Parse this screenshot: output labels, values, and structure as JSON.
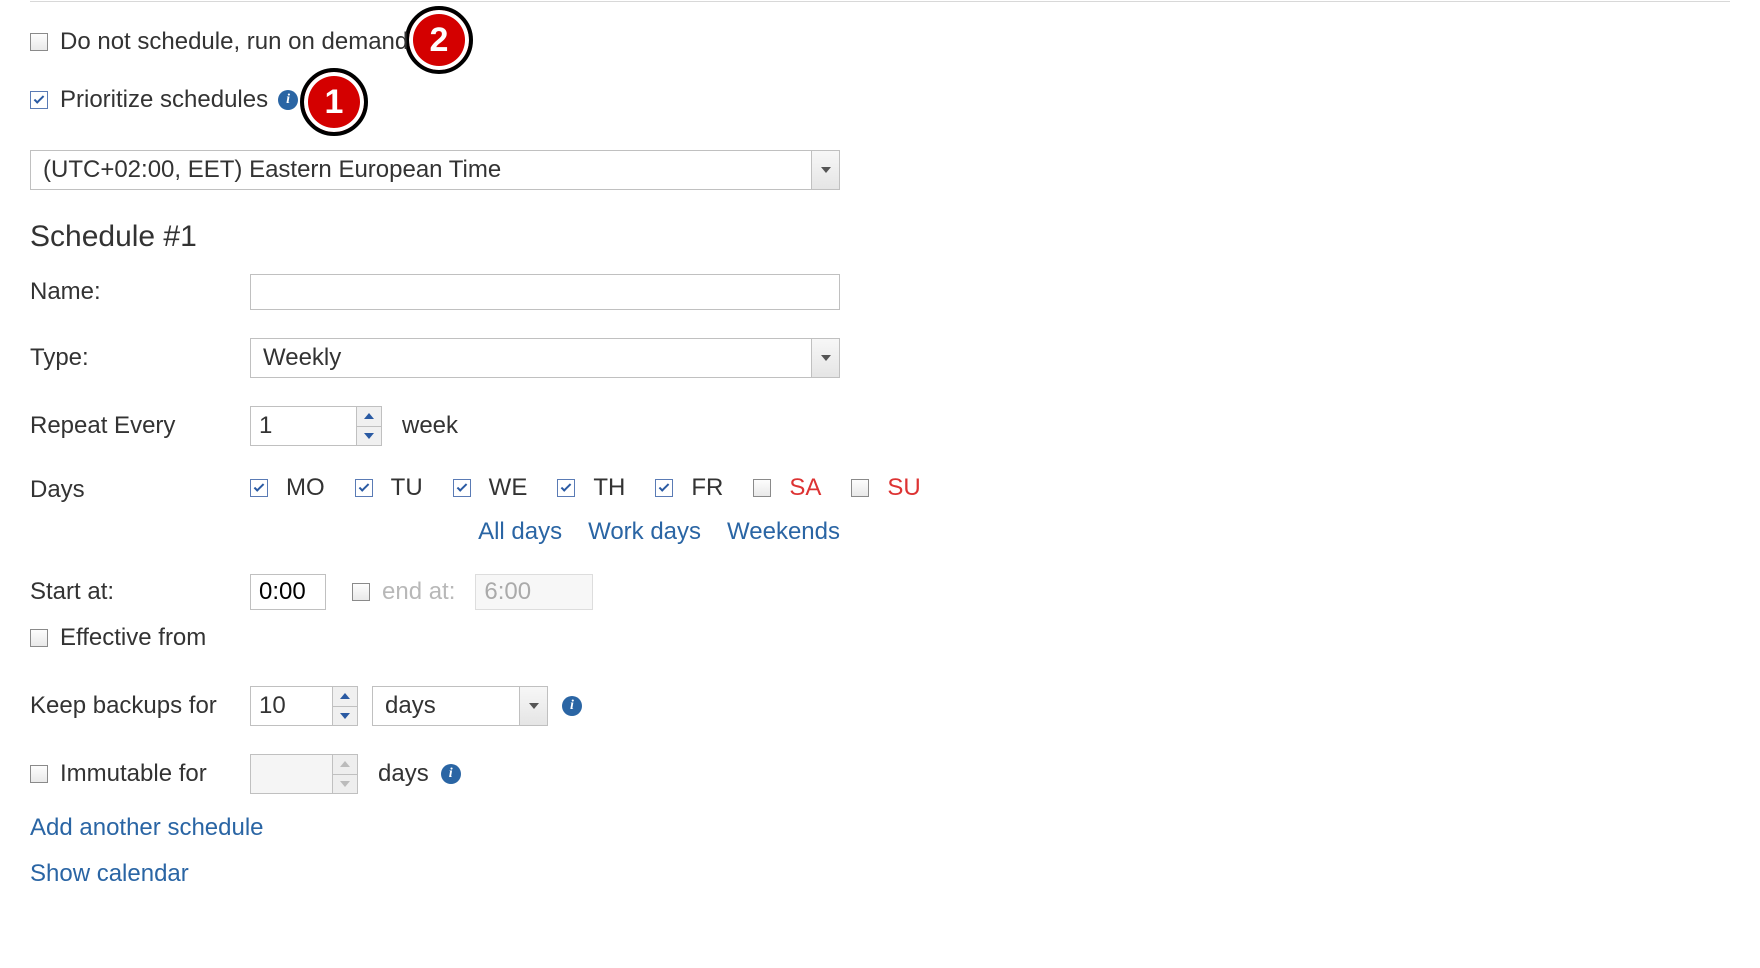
{
  "options": {
    "run_on_demand_label": "Do not schedule, run on demand",
    "prioritize_label": "Prioritize schedules",
    "timezone_selected": "(UTC+02:00, EET) Eastern European Time"
  },
  "badges": {
    "b1": "1",
    "b2": "2"
  },
  "schedule": {
    "heading": "Schedule #1",
    "name_label": "Name:",
    "name_value": "",
    "type_label": "Type:",
    "type_selected": "Weekly",
    "repeat_label": "Repeat Every",
    "repeat_value": "1",
    "repeat_unit": "week",
    "days_label": "Days",
    "days": [
      "MO",
      "TU",
      "WE",
      "TH",
      "FR",
      "SA",
      "SU"
    ],
    "presets": {
      "all": "All days",
      "work": "Work days",
      "weekends": "Weekends"
    },
    "start_label": "Start at:",
    "start_value": "0:00",
    "end_label": "end at:",
    "end_value": "6:00",
    "effective_label": "Effective from",
    "keep_label": "Keep backups for",
    "keep_value": "10",
    "keep_unit_selected": "days",
    "immutable_label": "Immutable for",
    "immutable_value": "",
    "immutable_unit": "days"
  },
  "links": {
    "add": "Add another schedule",
    "calendar": "Show calendar"
  }
}
